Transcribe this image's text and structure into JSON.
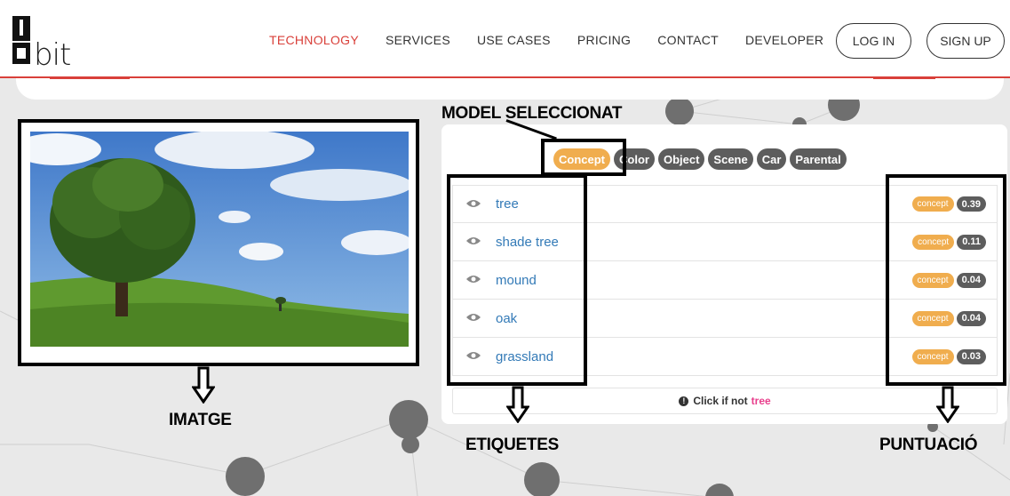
{
  "nav": {
    "items": [
      {
        "label": "TECHNOLOGY",
        "active": true
      },
      {
        "label": "SERVICES",
        "active": false
      },
      {
        "label": "USE CASES",
        "active": false
      },
      {
        "label": "PRICING",
        "active": false
      },
      {
        "label": "CONTACT",
        "active": false
      },
      {
        "label": "DEVELOPER",
        "active": false
      }
    ],
    "login": "LOG IN",
    "signup": "SIGN UP",
    "logo_text": "bit"
  },
  "annotations": {
    "model": "MODEL SELECCIONAT",
    "image": "IMATGE",
    "labels": "ETIQUETES",
    "score": "PUNTUACIÓ"
  },
  "models": [
    "Concept",
    "Color",
    "Object",
    "Scene",
    "Car",
    "Parental"
  ],
  "selected_model": "Concept",
  "results": [
    {
      "label": "tree",
      "type": "concept",
      "score": "0.39"
    },
    {
      "label": "shade tree",
      "type": "concept",
      "score": "0.11"
    },
    {
      "label": "mound",
      "type": "concept",
      "score": "0.04"
    },
    {
      "label": "oak",
      "type": "concept",
      "score": "0.04"
    },
    {
      "label": "grassland",
      "type": "concept",
      "score": "0.03"
    }
  ],
  "feedback": {
    "prefix": "Click if not",
    "term": "tree"
  },
  "colors": {
    "accent": "#d9403a",
    "pill": "#5d5d5d",
    "selected": "#f0ad4e",
    "link": "#337ab7"
  }
}
